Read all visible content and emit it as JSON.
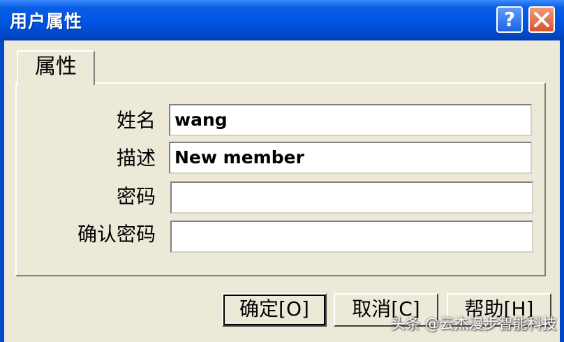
{
  "window": {
    "title": "用户属性"
  },
  "titlebar_buttons": {
    "help": "?",
    "close": "×"
  },
  "tabs": [
    {
      "label": "属性"
    }
  ],
  "fields": [
    {
      "label": "姓名",
      "value": "wang"
    },
    {
      "label": "描述",
      "value": "New member"
    },
    {
      "label": "密码",
      "value": ""
    },
    {
      "label": "确认密码",
      "value": ""
    }
  ],
  "buttons": {
    "ok": "确定[O]",
    "cancel": "取消[C]",
    "help": "帮助[H]"
  },
  "watermark": "头条 @云杰漫步智能科技",
  "colors": {
    "titlebar": "#0054E3",
    "dialog_bg": "#ECE9D8",
    "close": "#D9532C"
  }
}
